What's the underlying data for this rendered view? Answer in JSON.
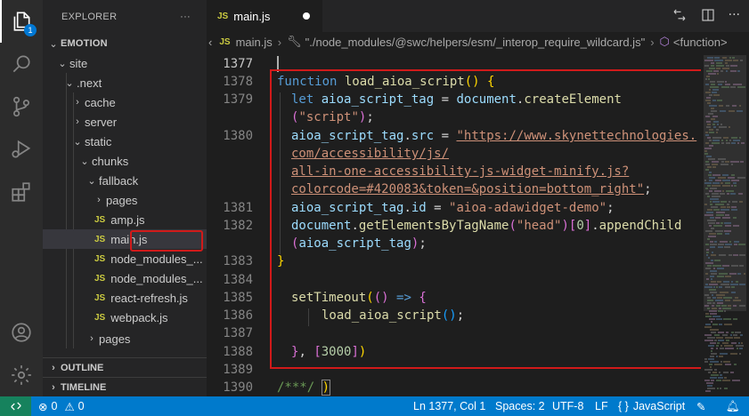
{
  "activity_bar": {
    "explorer_badge": "1"
  },
  "sidebar": {
    "title": "EXPLORER",
    "more": "···",
    "root": "EMOTION",
    "items": [
      {
        "label": "site"
      },
      {
        "label": ".next"
      },
      {
        "label": "cache"
      },
      {
        "label": "server"
      },
      {
        "label": "static"
      },
      {
        "label": "chunks"
      },
      {
        "label": "fallback"
      },
      {
        "label": "pages"
      },
      {
        "label": "amp.js",
        "badge": "JS"
      },
      {
        "label": "main.js",
        "badge": "JS"
      },
      {
        "label": "node_modules_...",
        "badge": "JS"
      },
      {
        "label": "node_modules_...",
        "badge": "JS"
      },
      {
        "label": "react-refresh.js",
        "badge": "JS"
      },
      {
        "label": "webpack.js",
        "badge": "JS"
      },
      {
        "label": "pages"
      }
    ],
    "outline": "OUTLINE",
    "timeline": "TIMELINE"
  },
  "tabs": [
    {
      "badge": "JS",
      "label": "main.js",
      "modified": true
    }
  ],
  "breadcrumb": {
    "file_badge": "JS",
    "file": "main.js",
    "path": "\"./node_modules/@swc/helpers/esm/_interop_require_wildcard.js\"",
    "symbol": "<function>"
  },
  "code": {
    "line_numbers": {
      "l0": "1377",
      "l1": "1378",
      "l2": "1379",
      "l3": "1380",
      "l4": "1381",
      "l5": "1382",
      "l6": "1383",
      "l7": "1384",
      "l8": "1385",
      "l9": "1386",
      "l10": "1387",
      "l11": "1388",
      "l12": "1389",
      "l13": "1390"
    },
    "lines": {
      "function_kw": "function",
      "function_name": "load_aioa_script",
      "let_kw": "let",
      "var_tag": "aioa_script_tag",
      "document": "document",
      "createElement": "createElement",
      "str_script": "\"script\"",
      "src_prop": "src",
      "url_1": "\"https://www.skynettechnologies.",
      "url_2": "com/accessibility/js/",
      "url_3": "all-in-one-accessibility-js-widget-minify.js?",
      "url_4": "colorcode=#420083&token=&position=bottom_right\"",
      "id_prop": "id",
      "str_id": "\"aioa-adawidget-demo\"",
      "getByTag": "getElementsByTagName",
      "str_head": "\"head\"",
      "num_zero": "0",
      "appendChild": "appendChild",
      "setTimeout": "setTimeout",
      "call_fn": "load_aioa_script",
      "num_3000": "3000",
      "comment": "/***/"
    }
  },
  "status_bar": {
    "errors": "0",
    "warnings": "0",
    "position": "Ln 1377, Col 1",
    "spaces": "Spaces: 2",
    "encoding": "UTF-8",
    "eol": "LF",
    "language": "JavaScript"
  }
}
